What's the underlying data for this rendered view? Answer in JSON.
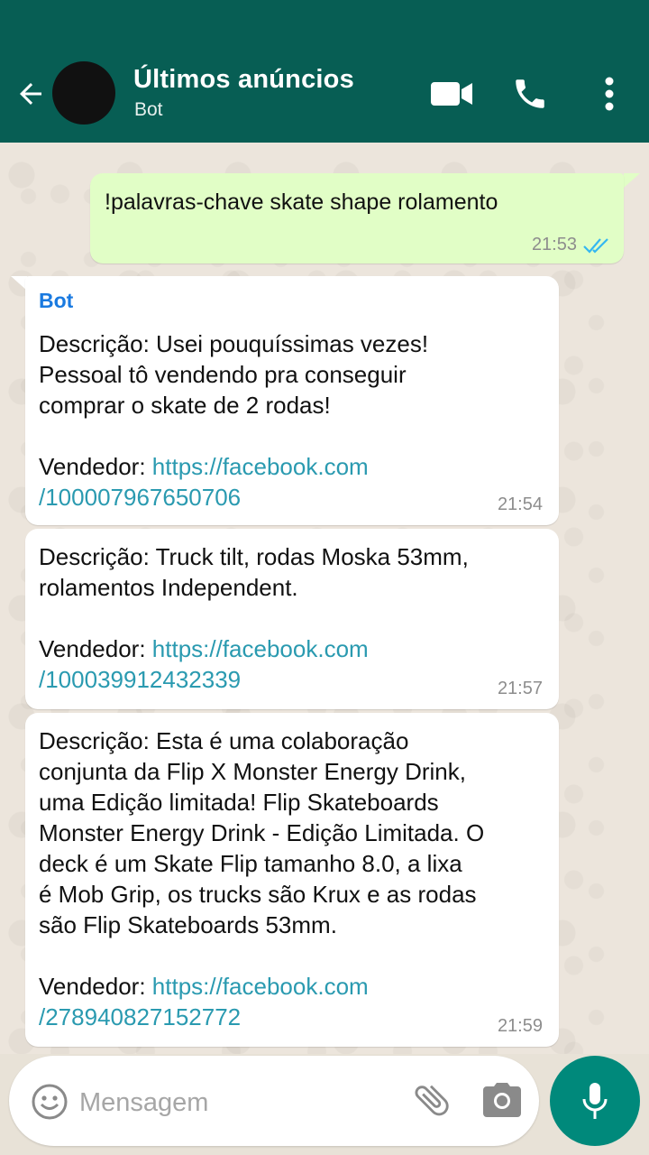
{
  "header": {
    "title": "Últimos anúncios",
    "subtitle": "Bot",
    "icons": [
      "back-arrow-icon",
      "video-icon",
      "phone-icon",
      "more-vert-icon"
    ],
    "color": "#075e54"
  },
  "messages": [
    {
      "direction": "outgoing",
      "text": "!palavras-chave skate shape rolamento",
      "time": "21:53",
      "status": "read"
    },
    {
      "direction": "incoming",
      "sender": "Bot",
      "description": "Descrição: Usei pouquíssimas vezes!\nPessoal tô vendendo pra conseguir\ncomprar o skate de 2 rodas!",
      "seller_label": "Vendedor: ",
      "link_line1": "https://facebook.com",
      "link_line2": "/100007967650706",
      "time": "21:54"
    },
    {
      "direction": "incoming",
      "description": "Descrição: Truck tilt, rodas Moska 53mm,\nrolamentos Independent.",
      "seller_label": "Vendedor: ",
      "link_line1": "https://facebook.com",
      "link_line2": "/100039912432339",
      "time": "21:57"
    },
    {
      "direction": "incoming",
      "description": "Descrição: Esta é uma colaboração\nconjunta da Flip X Monster Energy Drink,\numa Edição limitada! Flip Skateboards\nMonster Energy Drink - Edição Limitada. O\ndeck é um Skate Flip tamanho 8.0, a lixa\né Mob Grip, os trucks são Krux e as rodas\nsão Flip Skateboards 53mm.",
      "seller_label": "Vendedor: ",
      "link_line1": "https://facebook.com",
      "link_line2": "/278940827152772",
      "time": "21:59"
    }
  ],
  "composer": {
    "placeholder": "Mensagem",
    "icons": [
      "emoji-icon",
      "attach-icon",
      "camera-icon",
      "mic-icon"
    ],
    "accent": "#00897b"
  },
  "colors": {
    "outgoing_bubble": "#e1fec6",
    "link": "#2a9ab0",
    "sender": "#1a7ae0",
    "read_ticks": "#34b7f1"
  }
}
